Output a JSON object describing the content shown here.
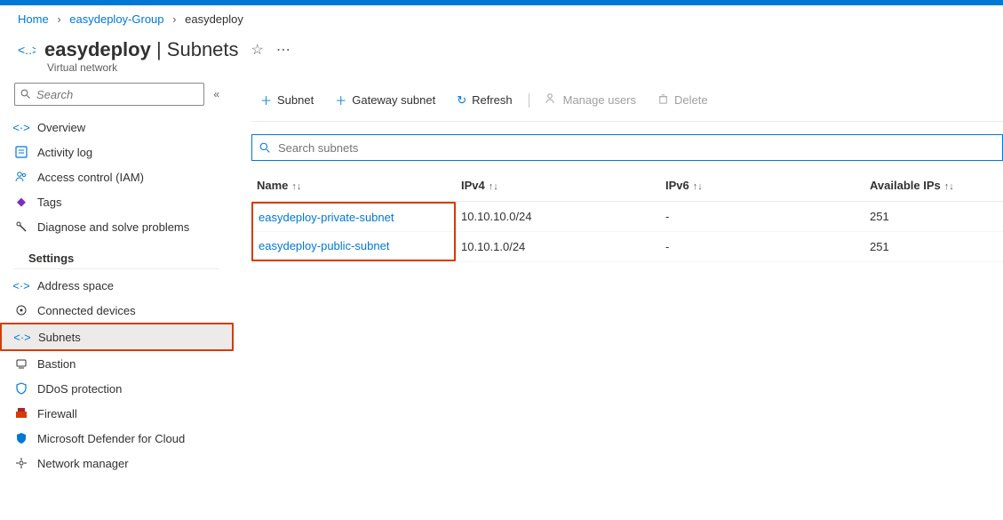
{
  "breadcrumb": {
    "home": "Home",
    "group": "easydeploy-Group",
    "resource": "easydeploy"
  },
  "header": {
    "title": "easydeploy",
    "separator": " | ",
    "page": "Subnets",
    "resource_type": "Virtual network"
  },
  "sidebar": {
    "search_placeholder": "Search",
    "items": {
      "overview": "Overview",
      "activity": "Activity log",
      "iam": "Access control (IAM)",
      "tags": "Tags",
      "diagnose": "Diagnose and solve problems"
    },
    "section_settings": "Settings",
    "settings_items": {
      "address_space": "Address space",
      "connected_devices": "Connected devices",
      "subnets": "Subnets",
      "bastion": "Bastion",
      "ddos": "DDoS protection",
      "firewall": "Firewall",
      "defender": "Microsoft Defender for Cloud",
      "network_manager": "Network manager"
    }
  },
  "toolbar": {
    "subnet": "Subnet",
    "gateway": "Gateway subnet",
    "refresh": "Refresh",
    "manage_users": "Manage users",
    "delete": "Delete"
  },
  "filter": {
    "placeholder": "Search subnets"
  },
  "table": {
    "headers": {
      "name": "Name",
      "ipv4": "IPv4",
      "ipv6": "IPv6",
      "available": "Available IPs"
    },
    "rows": [
      {
        "name": "easydeploy-private-subnet",
        "ipv4": "10.10.10.0/24",
        "ipv6": "-",
        "available": "251"
      },
      {
        "name": "easydeploy-public-subnet",
        "ipv4": "10.10.1.0/24",
        "ipv6": "-",
        "available": "251"
      }
    ]
  }
}
